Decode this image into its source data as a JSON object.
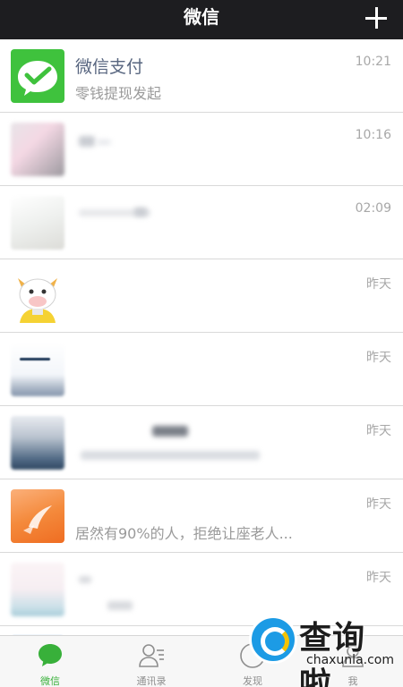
{
  "header": {
    "title": "微信",
    "add_icon": "plus-icon"
  },
  "chats": [
    {
      "name": "微信支付",
      "message": "零钱提现发起",
      "time": "10:21",
      "avatar": "wechat-pay-icon"
    },
    {
      "name": "",
      "message": "",
      "time": "10:16",
      "avatar": "blurred-avatar"
    },
    {
      "name": "",
      "message": "",
      "time": "02:09",
      "avatar": "blurred-avatar"
    },
    {
      "name": "",
      "message": "",
      "time": "昨天",
      "avatar": "cartoon-cow-avatar"
    },
    {
      "name": "",
      "message": "",
      "time": "昨天",
      "avatar": "blurred-avatar"
    },
    {
      "name": "",
      "message": "",
      "time": "昨天",
      "avatar": "blurred-avatar"
    },
    {
      "name": "",
      "message": "居然有90%的人，拒绝让座老人...",
      "time": "昨天",
      "avatar": "orange-app-avatar"
    },
    {
      "name": "",
      "message": "",
      "time": "昨天",
      "avatar": "blurred-avatar"
    }
  ],
  "tabbar": {
    "tabs": [
      {
        "label": "微信",
        "icon": "chat-bubble-icon",
        "active": true
      },
      {
        "label": "通讯录",
        "icon": "contacts-icon",
        "active": false
      },
      {
        "label": "发现",
        "icon": "compass-icon",
        "active": false
      },
      {
        "label": "我",
        "icon": "person-icon",
        "active": false
      }
    ]
  },
  "watermark": {
    "title": "查询啦",
    "url": "chaxunla.com"
  },
  "colors": {
    "topbar": "#1d1d20",
    "accent": "#38b03a",
    "pay_green": "#3fc23d",
    "name": "#57657f"
  }
}
